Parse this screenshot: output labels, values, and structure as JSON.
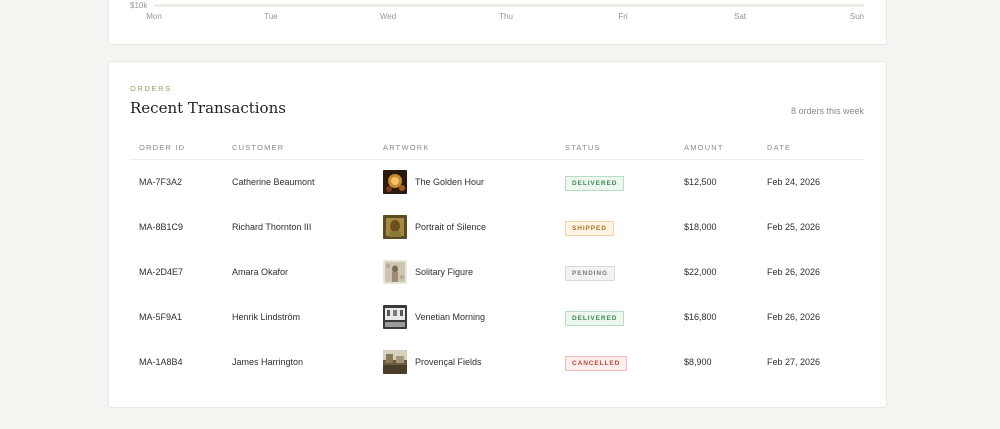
{
  "chart_card": {
    "y_tick": "$10k",
    "x_ticks": [
      "Mon",
      "Tue",
      "Wed",
      "Thu",
      "Fri",
      "Sat",
      "Sun"
    ]
  },
  "orders": {
    "eyebrow": "ORDERS",
    "title": "Recent Transactions",
    "meta": "8 orders this week",
    "columns": {
      "order_id": "ORDER ID",
      "customer": "CUSTOMER",
      "artwork": "ARTWORK",
      "status": "STATUS",
      "amount": "AMOUNT",
      "date": "DATE"
    },
    "rows": [
      {
        "order_id": "MA-7F3A2",
        "customer": "Catherine Beaumont",
        "artwork": "The Golden Hour",
        "status": "DELIVERED",
        "status_kind": "delivered",
        "amount": "$12,500",
        "date": "Feb 24, 2026"
      },
      {
        "order_id": "MA-8B1C9",
        "customer": "Richard Thornton III",
        "artwork": "Portrait of Silence",
        "status": "SHIPPED",
        "status_kind": "shipped",
        "amount": "$18,000",
        "date": "Feb 25, 2026"
      },
      {
        "order_id": "MA-2D4E7",
        "customer": "Amara Okafor",
        "artwork": "Solitary Figure",
        "status": "PENDING",
        "status_kind": "pending",
        "amount": "$22,000",
        "date": "Feb 26, 2026"
      },
      {
        "order_id": "MA-5F9A1",
        "customer": "Henrik Lindström",
        "artwork": "Venetian Morning",
        "status": "DELIVERED",
        "status_kind": "delivered",
        "amount": "$16,800",
        "date": "Feb 26, 2026"
      },
      {
        "order_id": "MA-1A8B4",
        "customer": "James Harrington",
        "artwork": "Provençal Fields",
        "status": "CANCELLED",
        "status_kind": "cancelled",
        "amount": "$8,900",
        "date": "Feb 27, 2026"
      }
    ]
  },
  "status_colors": {
    "delivered": {
      "text": "#3f8a4f",
      "bg": "#eef7ef",
      "border": "#b9ddc0"
    },
    "shipped": {
      "text": "#b5731f",
      "bg": "#fdf4e6",
      "border": "#efd3a6"
    },
    "pending": {
      "text": "#7c7c7c",
      "bg": "#f3f3f3",
      "border": "#d9d9d9"
    },
    "cancelled": {
      "text": "#c2453f",
      "bg": "#fdeeed",
      "border": "#f0bdb9"
    }
  },
  "artwork_thumbs": [
    "golden-hour-thumbnail",
    "portrait-of-silence-thumbnail",
    "solitary-figure-thumbnail",
    "venetian-morning-thumbnail",
    "provencal-fields-thumbnail"
  ]
}
